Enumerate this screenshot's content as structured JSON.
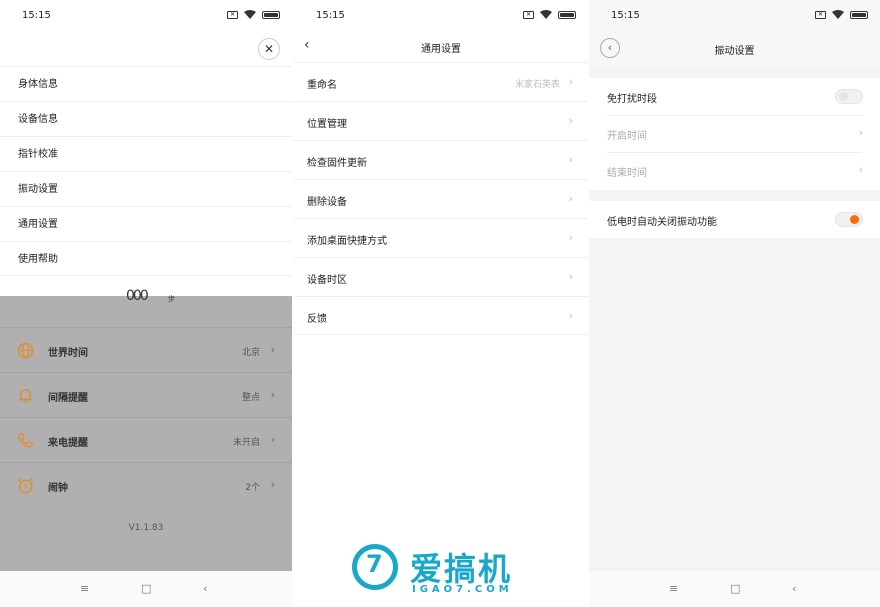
{
  "status_bar": {
    "time": "15:15"
  },
  "screen1": {
    "menu_items": [
      "身体信息",
      "设备信息",
      "指针校准",
      "振动设置",
      "通用设置",
      "使用帮助"
    ],
    "close_symbol": "✕",
    "steps_value": "000",
    "steps_unit": "步",
    "rows": [
      {
        "label": "世界时间",
        "value": "北京",
        "icon": "globe-icon"
      },
      {
        "label": "间隔提醒",
        "value": "整点",
        "icon": "bell-icon"
      },
      {
        "label": "来电提醒",
        "value": "未开启",
        "icon": "phone-icon"
      },
      {
        "label": "闹钟",
        "value": "2个",
        "icon": "alarm-clock-icon"
      }
    ],
    "version": "V1.1.83",
    "accent_color": "#e58a2e"
  },
  "screen2": {
    "title": "通用设置",
    "rows": [
      {
        "label": "重命名",
        "value": "米家石英表"
      },
      {
        "label": "位置管理",
        "value": ""
      },
      {
        "label": "检查固件更新",
        "value": ""
      },
      {
        "label": "删除设备",
        "value": ""
      },
      {
        "label": "添加桌面快捷方式",
        "value": ""
      },
      {
        "label": "设备时区",
        "value": ""
      },
      {
        "label": "反馈",
        "value": ""
      }
    ]
  },
  "screen3": {
    "title": "振动设置",
    "dnd_label": "免打扰时段",
    "dnd_enabled": false,
    "start_label": "开启时间",
    "end_label": "结束时间",
    "low_power_label": "低电时自动关闭振动功能",
    "low_power_enabled": true,
    "toggle_on_color": "#ff6b00"
  },
  "watermark": {
    "logo_number": "7",
    "brand": "爱搞机",
    "site": "IGAO7.COM",
    "color": "#1aa8c8"
  },
  "nav_icons": [
    "menu-icon",
    "home-icon",
    "back-icon"
  ]
}
